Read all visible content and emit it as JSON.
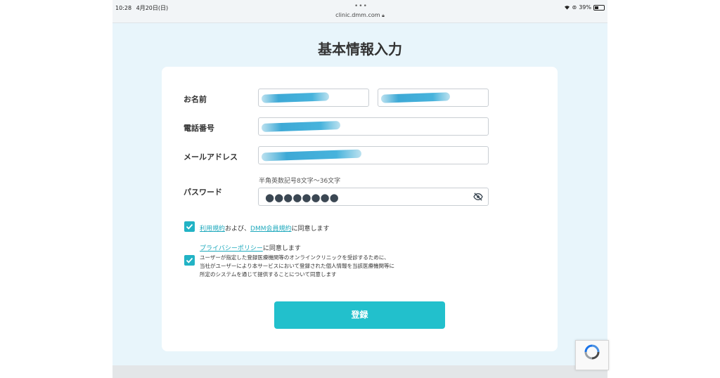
{
  "status_bar": {
    "time": "10:28",
    "date": "4月20日(日)",
    "battery": "39%"
  },
  "browser": {
    "url": "clinic.dmm.com"
  },
  "page": {
    "title": "基本情報入力"
  },
  "form": {
    "name_label": "お名前",
    "phone_label": "電話番号",
    "email_label": "メールアドレス",
    "password_label": "パスワード",
    "password_hint": "半角英数記号8文字〜36文字",
    "password_mask": "●●●●●●●●"
  },
  "agreements": {
    "terms_link": "利用規約",
    "terms_mid": "および、",
    "dmm_terms_link": "DMM会員規約",
    "terms_suffix": "に同意します",
    "privacy_link": "プライバシーポリシー",
    "privacy_suffix": "に同意します",
    "consent_lines": [
      "ユーザーが指定した登録医療機関等のオンラインクリニックを受診するために、",
      "当社がユーザーにより本サービスにおいて登録された個人情報を当該医療機関等に",
      "所定のシステムを通じて提供することについて同意します"
    ]
  },
  "submit": {
    "label": "登録"
  },
  "colors": {
    "accent": "#22c0cc",
    "link": "#1fa9bd",
    "background": "#e8f5fb"
  }
}
